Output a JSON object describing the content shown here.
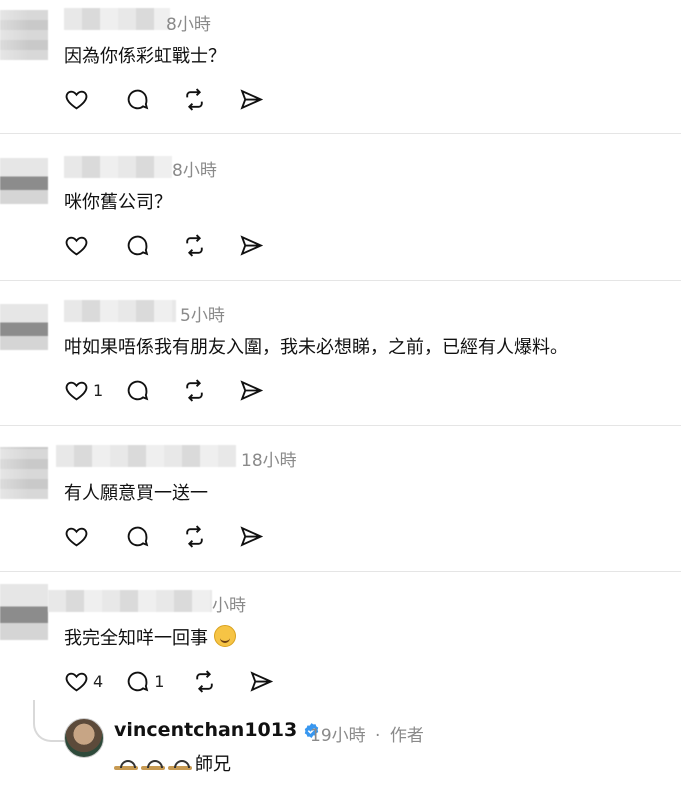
{
  "comments": [
    {
      "time": "8小時",
      "text": "因為你係彩虹戰士？",
      "like_count": "",
      "comment_count": ""
    },
    {
      "time": "8小時",
      "text": "咪你舊公司？",
      "like_count": "",
      "comment_count": ""
    },
    {
      "time": "5小時",
      "text": "咁如果唔係我有朋友入圍，我未必想睇，之前，已經有人爆料。",
      "like_count": "1",
      "comment_count": ""
    },
    {
      "time": "18小時",
      "text": "有人願意買一送一",
      "like_count": "",
      "comment_count": ""
    },
    {
      "time": "小時",
      "text": "我完全知咩一回事",
      "emoji": "woozy-face",
      "like_count": "4",
      "comment_count": "1"
    }
  ],
  "reply": {
    "username": "vincentchan1013",
    "time": "19小時",
    "separator": "·",
    "author_tag": "作者",
    "text": "師兄",
    "emoji": "sandal x3"
  },
  "icons": [
    "heart-icon",
    "comment-icon",
    "repost-icon",
    "share-icon",
    "verified-badge-icon"
  ],
  "colors": {
    "verified": "#3897f0",
    "muted": "#8a8a8a",
    "divider": "#e5e5e5"
  }
}
